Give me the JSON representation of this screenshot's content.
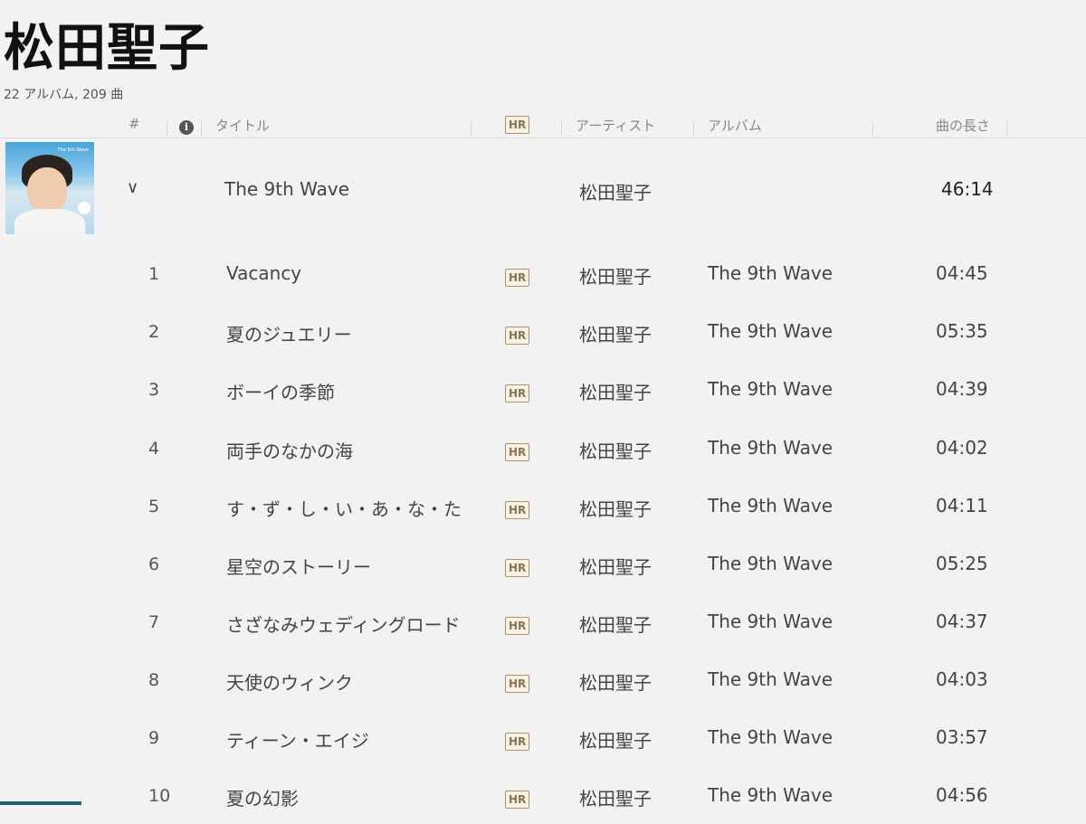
{
  "artist_page": {
    "title": "松田聖子",
    "subtitle": "22 アルバム, 209 曲"
  },
  "columns": {
    "number": "#",
    "title": "タイトル",
    "hr": "HR",
    "artist": "アーティスト",
    "album": "アルバム",
    "duration": "曲の長さ"
  },
  "icons": {
    "info": "info-icon",
    "expand": "chevron-down-icon",
    "hr_badge": "hi-res-badge"
  },
  "album": {
    "title": "The 9th Wave",
    "artist": "松田聖子",
    "duration": "46:14",
    "art_caption": "The 9th Wave",
    "chevron": "∨"
  },
  "tracks": [
    {
      "num": "1",
      "title": "Vacancy",
      "hr": "HR",
      "artist": "松田聖子",
      "album": "The 9th Wave",
      "duration": "04:45"
    },
    {
      "num": "2",
      "title": "夏のジュエリー",
      "hr": "HR",
      "artist": "松田聖子",
      "album": "The 9th Wave",
      "duration": "05:35"
    },
    {
      "num": "3",
      "title": "ボーイの季節",
      "hr": "HR",
      "artist": "松田聖子",
      "album": "The 9th Wave",
      "duration": "04:39"
    },
    {
      "num": "4",
      "title": "両手のなかの海",
      "hr": "HR",
      "artist": "松田聖子",
      "album": "The 9th Wave",
      "duration": "04:02"
    },
    {
      "num": "5",
      "title": "す・ず・し・い・あ・な・た",
      "hr": "HR",
      "artist": "松田聖子",
      "album": "The 9th Wave",
      "duration": "04:11"
    },
    {
      "num": "6",
      "title": "星空のストーリー",
      "hr": "HR",
      "artist": "松田聖子",
      "album": "The 9th Wave",
      "duration": "05:25"
    },
    {
      "num": "7",
      "title": "さざなみウェディングロード",
      "hr": "HR",
      "artist": "松田聖子",
      "album": "The 9th Wave",
      "duration": "04:37"
    },
    {
      "num": "8",
      "title": "天使のウィンク",
      "hr": "HR",
      "artist": "松田聖子",
      "album": "The 9th Wave",
      "duration": "04:03"
    },
    {
      "num": "9",
      "title": "ティーン・エイジ",
      "hr": "HR",
      "artist": "松田聖子",
      "album": "The 9th Wave",
      "duration": "03:57"
    },
    {
      "num": "10",
      "title": "夏の幻影",
      "hr": "HR",
      "artist": "松田聖子",
      "album": "The 9th Wave",
      "duration": "04:56"
    }
  ],
  "colors": {
    "background": "#f2f2f2",
    "hr_badge_border": "#a89468",
    "bottom_accent": "#2a5f6e"
  }
}
